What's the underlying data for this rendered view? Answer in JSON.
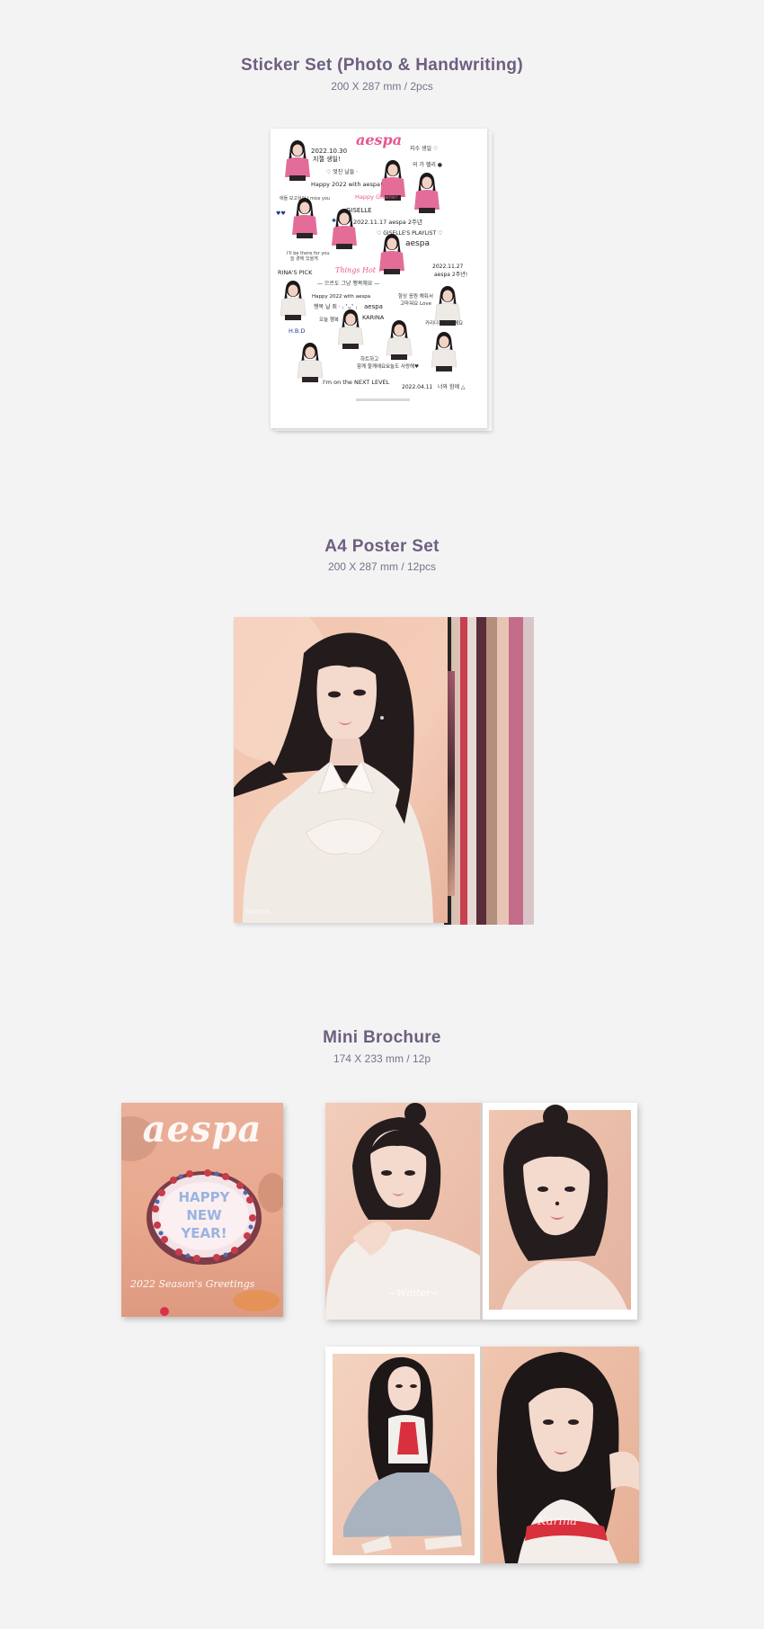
{
  "sections": [
    {
      "title": "Sticker Set (Photo & Handwriting)",
      "subtitle": "200 X 287 mm / 2pcs"
    },
    {
      "title": "A4 Poster Set",
      "subtitle": "200 X 287 mm / 12pcs"
    },
    {
      "title": "Mini Brochure",
      "subtitle": "174 X 233 mm / 12p"
    }
  ],
  "sticker_sheet": {
    "logo": "aespa",
    "notes": [
      "2022.10.30",
      "지젤 생일!",
      "Happy 2022 with aespa!",
      "GISELLE",
      "2022.11.17 aespa 2주년",
      "aespa",
      "RINA'S PICK",
      "Happy 2022 with aespa",
      "KARINA",
      "H.B.D",
      "I'm on the NEXT LEVEL",
      "2022.04.11",
      "2022.11.27"
    ]
  },
  "brochure": {
    "cover_logo": "aespa",
    "cake_lines": [
      "HAPPY",
      "NEW",
      "YEAR!"
    ],
    "cover_footer": "2022 Season's Greetings"
  },
  "colors": {
    "title": "#6d5f7f",
    "subtitle": "#7b7088",
    "background": "#f3f3f4",
    "sticker_pink": "#e8578f"
  }
}
